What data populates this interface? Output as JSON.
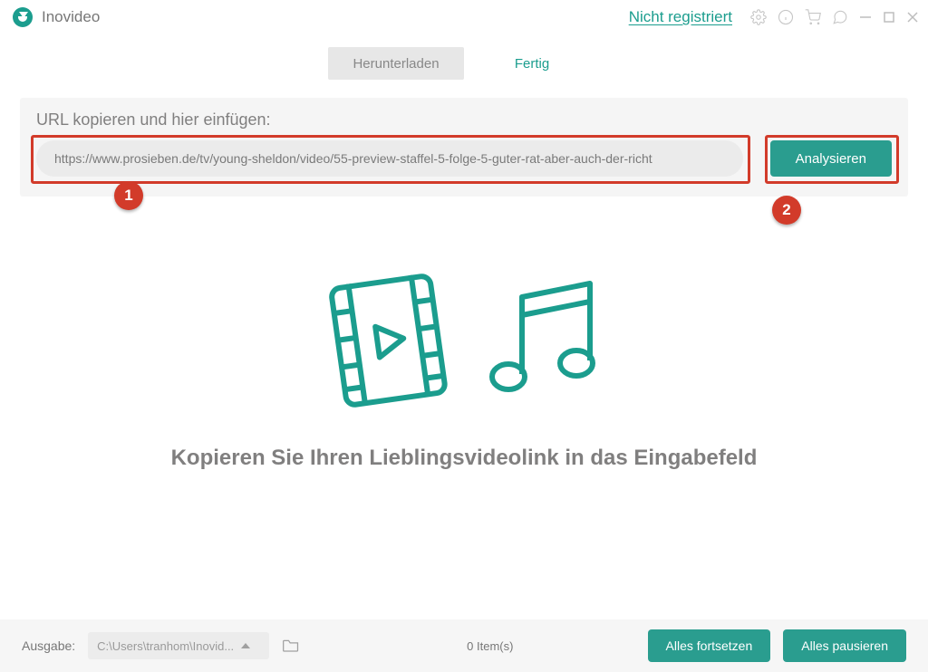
{
  "header": {
    "app_name": "Inovideo",
    "not_registered": "Nicht registriert"
  },
  "tabs": {
    "download": "Herunterladen",
    "done": "Fertig"
  },
  "url_panel": {
    "label": "URL kopieren und hier einfügen:",
    "input_value": "https://www.prosieben.de/tv/young-sheldon/video/55-preview-staffel-5-folge-5-guter-rat-aber-auch-der-richt",
    "analyze_label": "Analysieren"
  },
  "badges": {
    "one": "1",
    "two": "2"
  },
  "center": {
    "instruction": "Kopieren Sie Ihren Lieblingsvideolink in das Eingabefeld"
  },
  "footer": {
    "output_label": "Ausgabe:",
    "output_path": "C:\\Users\\tranhom\\Inovid...",
    "items_count": "0 Item(s)",
    "resume_all": "Alles fortsetzen",
    "pause_all": "Alles pausieren"
  }
}
